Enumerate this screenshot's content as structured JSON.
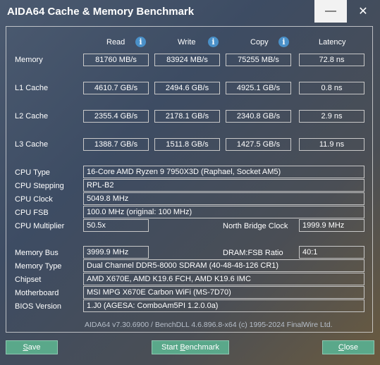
{
  "window": {
    "title": "AIDA64 Cache & Memory Benchmark",
    "minimize_glyph": "—",
    "close_glyph": "✕"
  },
  "columns": {
    "read": "Read",
    "write": "Write",
    "copy": "Copy",
    "latency": "Latency",
    "info_glyph": "i"
  },
  "rows": {
    "memory": {
      "label": "Memory",
      "read": "81760 MB/s",
      "write": "83924 MB/s",
      "copy": "75255 MB/s",
      "latency": "72.8 ns"
    },
    "l1": {
      "label": "L1 Cache",
      "read": "4610.7 GB/s",
      "write": "2494.6 GB/s",
      "copy": "4925.1 GB/s",
      "latency": "0.8 ns"
    },
    "l2": {
      "label": "L2 Cache",
      "read": "2355.4 GB/s",
      "write": "2178.1 GB/s",
      "copy": "2340.8 GB/s",
      "latency": "2.9 ns"
    },
    "l3": {
      "label": "L3 Cache",
      "read": "1388.7 GB/s",
      "write": "1511.8 GB/s",
      "copy": "1427.5 GB/s",
      "latency": "11.9 ns"
    }
  },
  "cpu": {
    "type_label": "CPU Type",
    "type_value": "16-Core AMD Ryzen 9 7950X3D  (Raphael, Socket AM5)",
    "stepping_label": "CPU Stepping",
    "stepping_value": "RPL-B2",
    "clock_label": "CPU Clock",
    "clock_value": "5049.8 MHz",
    "fsb_label": "CPU FSB",
    "fsb_value": "100.0 MHz  (original: 100 MHz)",
    "multiplier_label": "CPU Multiplier",
    "multiplier_value": "50.5x",
    "nb_clock_label": "North Bridge Clock",
    "nb_clock_value": "1999.9 MHz"
  },
  "system": {
    "membus_label": "Memory Bus",
    "membus_value": "3999.9 MHz",
    "dram_fsb_label": "DRAM:FSB Ratio",
    "dram_fsb_value": "40:1",
    "memtype_label": "Memory Type",
    "memtype_value": "Dual Channel DDR5-8000 SDRAM  (40-48-48-126 CR1)",
    "chipset_label": "Chipset",
    "chipset_value": "AMD X670E, AMD K19.6 FCH, AMD K19.6 IMC",
    "motherboard_label": "Motherboard",
    "motherboard_value": "MSI MPG X670E Carbon WiFi (MS-7D70)",
    "bios_label": "BIOS Version",
    "bios_value": "1.J0  (AGESA: ComboAm5PI 1.2.0.0a)"
  },
  "footer": {
    "text": "AIDA64 v7.30.6900 / BenchDLL 4.6.896.8-x64  (c) 1995-2024 FinalWire Ltd."
  },
  "buttons": {
    "save_hotkey": "S",
    "save_rest": "ave",
    "start_pre": "Start ",
    "start_hotkey": "B",
    "start_rest": "enchmark",
    "close_hotkey": "C",
    "close_rest": "lose"
  }
}
